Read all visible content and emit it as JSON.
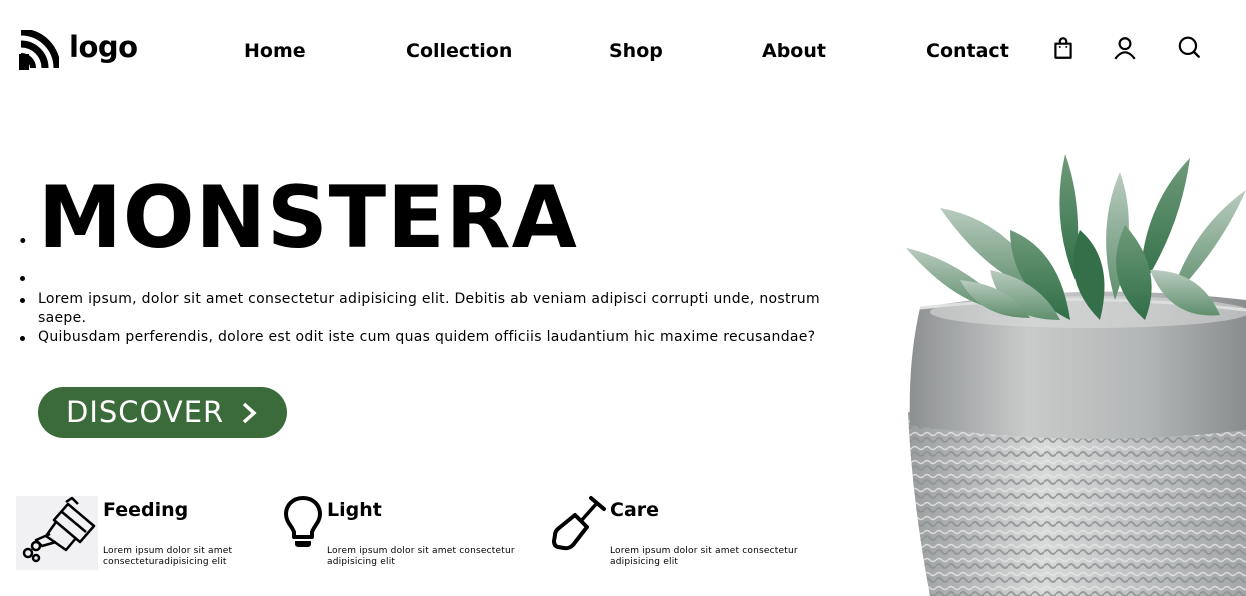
{
  "header": {
    "logo_text": "logo",
    "nav": [
      {
        "label": "Home"
      },
      {
        "label": "Collection"
      },
      {
        "label": "Shop"
      },
      {
        "label": "About"
      },
      {
        "label": "Contact"
      }
    ],
    "icons": [
      "shopping-bag-icon",
      "user-icon",
      "search-icon"
    ]
  },
  "hero": {
    "title": "MONSTERA",
    "paragraphs": [
      "Lorem ipsum, dolor sit amet consectetur adipisicing elit. Debitis ab veniam adipisci corrupti unde, nostrum saepe.",
      "Quibusdam perferendis, dolore est odit iste cum quas quidem officiis laudantium hic maxime recusandae?"
    ],
    "cta_label": "DISCOVER",
    "cta_color": "#3b6b3a"
  },
  "features": [
    {
      "title": "Feeding",
      "desc_lines": [
        "Lorem ipsum dolor sit amet",
        "consecteturadipisicing elit"
      ],
      "icon": "watering-can-icon"
    },
    {
      "title": "Light",
      "desc_lines": [
        "Lorem ipsum dolor sit amet consectetur",
        "adipisicing elit"
      ],
      "icon": "lightbulb-icon"
    },
    {
      "title": "Care",
      "desc_lines": [
        "Lorem ipsum dolor sit amet consectetur",
        "adipisicing elit"
      ],
      "icon": "shovel-icon"
    }
  ],
  "image": {
    "subject": "succulent-in-concrete-pot"
  }
}
